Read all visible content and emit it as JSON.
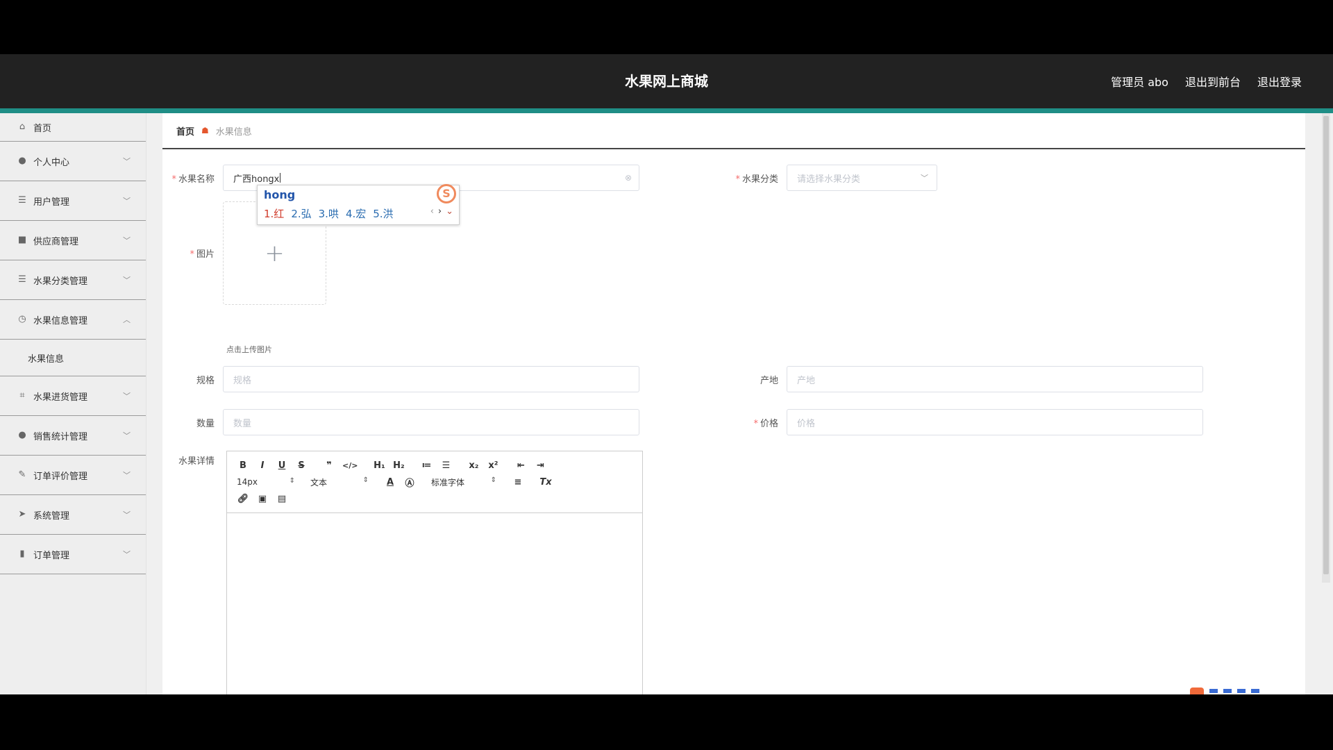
{
  "header": {
    "title": "水果网上商城",
    "admin": "管理员 abo",
    "to_front": "退出到前台",
    "logout": "退出登录"
  },
  "sidebar": {
    "items": [
      {
        "label": "首页",
        "icon": "home-icon"
      },
      {
        "label": "个人中心",
        "icon": "user-icon"
      },
      {
        "label": "用户管理",
        "icon": "list-icon"
      },
      {
        "label": "供应商管理",
        "icon": "box-icon"
      },
      {
        "label": "水果分类管理",
        "icon": "list-icon"
      },
      {
        "label": "水果信息管理",
        "icon": "compass-icon"
      },
      {
        "label": "水果进货管理",
        "icon": "crop-icon"
      },
      {
        "label": "销售统计管理",
        "icon": "balloon-icon"
      },
      {
        "label": "订单评价管理",
        "icon": "edit-icon"
      },
      {
        "label": "系统管理",
        "icon": "send-icon"
      },
      {
        "label": "订单管理",
        "icon": "bar-chart-icon"
      }
    ],
    "sub_item": "水果信息"
  },
  "breadcrumb": {
    "home": "首页",
    "current": "水果信息"
  },
  "form": {
    "name_label": "水果名称",
    "name_value": "广西hongx",
    "category_label": "水果分类",
    "category_placeholder": "请选择水果分类",
    "image_label": "图片",
    "upload_hint": "点击上传图片",
    "spec_label": "规格",
    "spec_placeholder": "规格",
    "origin_label": "产地",
    "origin_placeholder": "产地",
    "qty_label": "数量",
    "qty_placeholder": "数量",
    "price_label": "价格",
    "price_placeholder": "价格",
    "detail_label": "水果详情"
  },
  "editor": {
    "font_size": "14px",
    "header_select": "文本",
    "font_family": "标准字体"
  },
  "ime": {
    "pinyin": "hong",
    "candidates": [
      "1.红",
      "2.弘",
      "3.哄",
      "4.宏",
      "5.洪"
    ]
  }
}
